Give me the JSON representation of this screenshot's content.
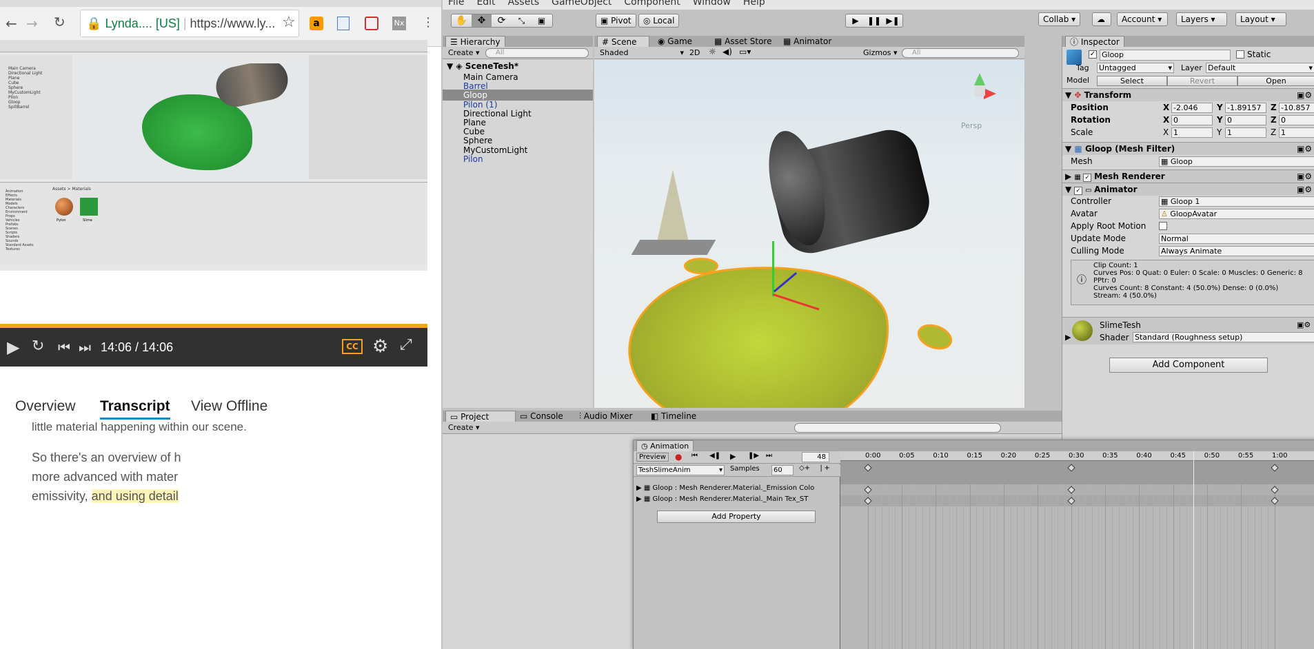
{
  "browser": {
    "tab_titles": [
      "",
      "",
      "",
      "",
      ""
    ],
    "address": {
      "site": "Lynda.... [US]",
      "url": "https://www.ly..."
    },
    "player": {
      "time": "14:06 / 14:06",
      "cc": "CC"
    },
    "tabs": [
      "Overview",
      "Transcript",
      "View Offline"
    ],
    "active_tab": "Transcript",
    "transcript_lines": [
      "little material happening within our scene.",
      "So there's an overview of h",
      "more advanced with mater",
      "emissivity, "
    ],
    "transcript_highlight": "and using detail",
    "thumb": {
      "hierarchy_items": [
        "Main Camera",
        "Directional Light",
        "Plane",
        "Cube",
        "Sphere",
        "MyCustomLight",
        "Pilon",
        "Gloop",
        "SpillBarrel"
      ],
      "project_items": [
        "Animation",
        "Effects",
        "Materials",
        "Models",
        "Characters",
        "Environment",
        "Props",
        "Vehicles",
        "Prefabs",
        "Scenes",
        "Scripts",
        "Shaders",
        "Sounds",
        "Standard Assets",
        "Textures"
      ],
      "assets_path": "Assets > Materials",
      "asset_names": [
        "Pylon",
        "Slime"
      ]
    }
  },
  "unity": {
    "menu": [
      "File",
      "Edit",
      "Assets",
      "GameObject",
      "Component",
      "Window",
      "Help"
    ],
    "toolbar": {
      "pivot": "Pivot",
      "local": "Local",
      "collab": "Collab",
      "account": "Account",
      "layers": "Layers",
      "layout": "Layout"
    },
    "hierarchy": {
      "tab": "Hierarchy",
      "create": "Create",
      "search": "All",
      "scene": "SceneTesh*",
      "items": [
        {
          "label": "Main Camera",
          "state": "normal"
        },
        {
          "label": "Barrel",
          "state": "prefab"
        },
        {
          "label": "Gloop",
          "state": "selected"
        },
        {
          "label": "Pilon (1)",
          "state": "prefab"
        },
        {
          "label": "Directional Light",
          "state": "normal"
        },
        {
          "label": "Plane",
          "state": "normal"
        },
        {
          "label": "Cube",
          "state": "normal"
        },
        {
          "label": "Sphere",
          "state": "normal"
        },
        {
          "label": "MyCustomLight",
          "state": "normal"
        },
        {
          "label": "Pilon",
          "state": "prefab"
        }
      ]
    },
    "scene": {
      "tabs": [
        "Scene",
        "Game",
        "Asset Store",
        "Animator"
      ],
      "shading": "Shaded",
      "mode2d": "2D",
      "gizmos": "Gizmos",
      "search": "All",
      "persp": "Persp"
    },
    "inspector": {
      "tab": "Inspector",
      "object_name": "Gloop",
      "static_label": "Static",
      "tag_label": "Tag",
      "tag": "Untagged",
      "layer_label": "Layer",
      "layer": "Default",
      "model_label": "Model",
      "select": "Select",
      "revert": "Revert",
      "open": "Open",
      "transform": {
        "title": "Transform",
        "position_label": "Position",
        "position": [
          "-2.046",
          "-1.89157",
          "-10.857"
        ],
        "rotation_label": "Rotation",
        "rotation": [
          "0",
          "0",
          "0"
        ],
        "scale_label": "Scale",
        "scale": [
          "1",
          "1",
          "1"
        ],
        "axes": [
          "X",
          "Y",
          "Z"
        ]
      },
      "mesh_filter": {
        "title": "Gloop (Mesh Filter)",
        "mesh_label": "Mesh",
        "mesh": "Gloop"
      },
      "mesh_renderer": {
        "title": "Mesh Renderer"
      },
      "animator": {
        "title": "Animator",
        "controller_label": "Controller",
        "controller": "Gloop 1",
        "avatar_label": "Avatar",
        "avatar": "GloopAvatar",
        "apply_root_label": "Apply Root Motion",
        "update_label": "Update Mode",
        "update": "Normal",
        "culling_label": "Culling Mode",
        "culling": "Always Animate",
        "info": [
          "Clip Count: 1",
          "Curves Pos: 0 Quat: 0 Euler: 0 Scale: 0 Muscles: 0 Generic: 8",
          "PPtr: 0",
          "Curves Count: 8 Constant: 4 (50.0%) Dense: 0 (0.0%)",
          "Stream: 4 (50.0%)"
        ]
      },
      "material": {
        "name": "SlimeTesh",
        "shader_label": "Shader",
        "shader": "Standard (Roughness setup)"
      },
      "add_component": "Add Component"
    },
    "project": {
      "tabs": [
        "Project",
        "Console",
        "Audio Mixer",
        "Timeline"
      ],
      "create": "Create"
    },
    "animation": {
      "title": "Animation",
      "preview": "Preview",
      "frame": "48",
      "clip": "TeshSlimeAnim",
      "samples_label": "Samples",
      "samples": "60",
      "properties": [
        "Gloop : Mesh Renderer.Material._Emission Colo",
        "Gloop : Mesh Renderer.Material._Main Tex_ST"
      ],
      "add_property": "Add Property",
      "timeline_ticks": [
        "0:00",
        "0:05",
        "0:10",
        "0:15",
        "0:20",
        "0:25",
        "0:30",
        "0:35",
        "0:40",
        "0:45",
        "0:50",
        "0:55",
        "1:00"
      ],
      "keyframe_times": [
        0,
        30,
        60
      ],
      "playhead_time": 48
    }
  }
}
